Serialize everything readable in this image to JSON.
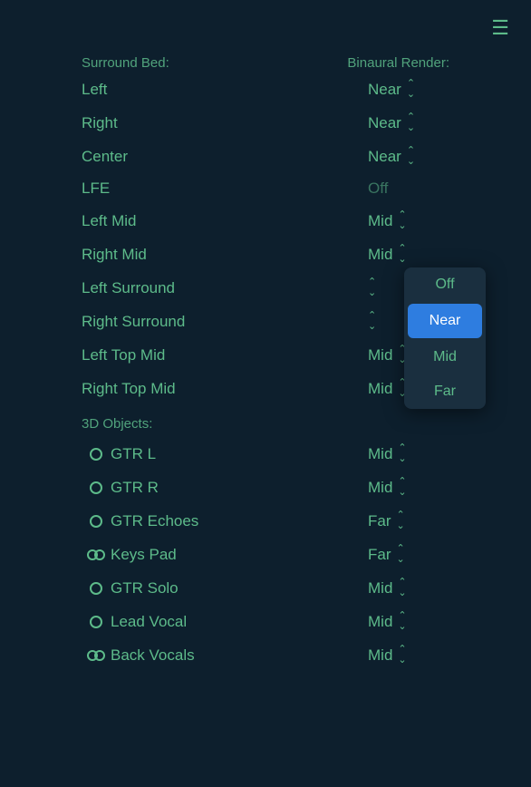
{
  "header": {
    "menu_icon": "☰"
  },
  "surround_bed": {
    "label": "Surround Bed:",
    "items": [
      {
        "name": "Left",
        "value": "Near",
        "off": false
      },
      {
        "name": "Right",
        "value": "Near",
        "off": false
      },
      {
        "name": "Center",
        "value": "Near",
        "off": false
      },
      {
        "name": "LFE",
        "value": "Off",
        "off": true
      },
      {
        "name": "Left Mid",
        "value": "Mid",
        "off": false
      },
      {
        "name": "Right Mid",
        "value": "Mid",
        "off": false
      },
      {
        "name": "Left Surround",
        "value": "",
        "off": false,
        "has_dropdown": true
      },
      {
        "name": "Right Surround",
        "value": "",
        "off": false,
        "dropdown_open": true
      },
      {
        "name": "Left Top Mid",
        "value": "Mid",
        "off": false
      },
      {
        "name": "Right Top Mid",
        "value": "Mid",
        "off": false
      }
    ]
  },
  "binaural_render_label": "Binaural Render:",
  "dropdown": {
    "options": [
      "Off",
      "Near",
      "Mid",
      "Far"
    ],
    "selected": "Near"
  },
  "objects_section": {
    "label": "3D Objects:",
    "items": [
      {
        "name": "GTR L",
        "value": "Mid",
        "icon": "circle"
      },
      {
        "name": "GTR R",
        "value": "Mid",
        "icon": "circle"
      },
      {
        "name": "GTR Echoes",
        "value": "Far",
        "icon": "circle"
      },
      {
        "name": "Keys Pad",
        "value": "Far",
        "icon": "link"
      },
      {
        "name": "GTR Solo",
        "value": "Mid",
        "icon": "circle"
      },
      {
        "name": "Lead Vocal",
        "value": "Mid",
        "icon": "circle"
      },
      {
        "name": "Back Vocals",
        "value": "Mid",
        "icon": "link"
      }
    ]
  }
}
